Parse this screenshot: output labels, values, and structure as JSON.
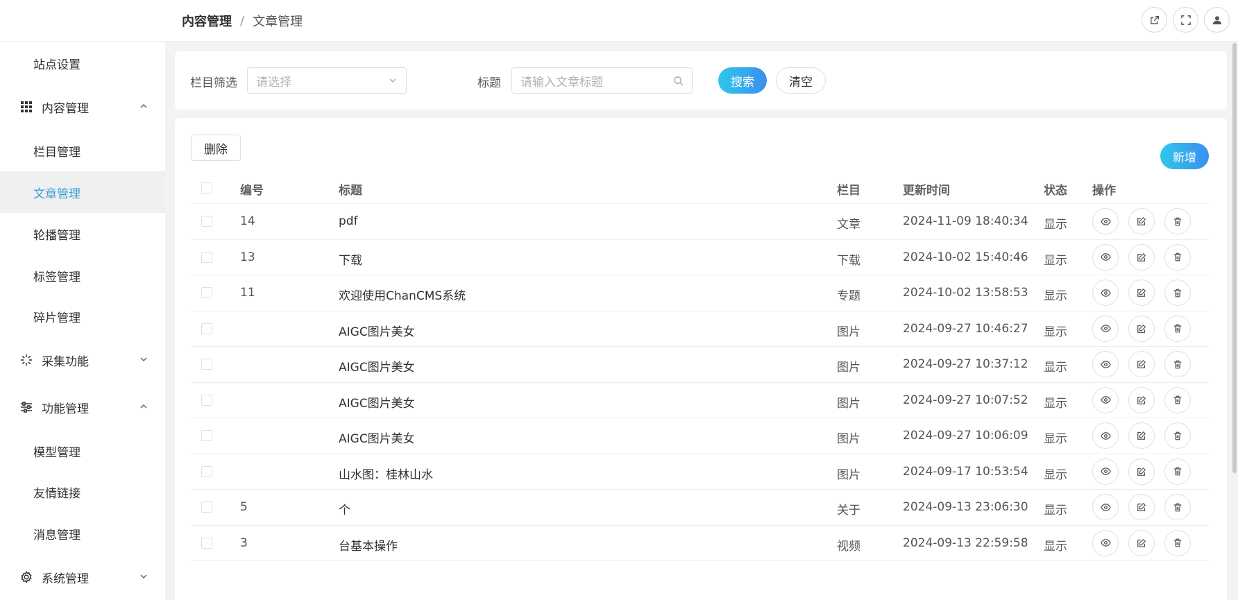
{
  "header": {
    "breadcrumb": [
      "内容管理",
      "文章管理"
    ],
    "icons": [
      "external-link-icon",
      "fullscreen-icon",
      "user-icon"
    ]
  },
  "sidebar": {
    "items": [
      {
        "label": "站点设置",
        "type": "sub"
      },
      {
        "label": "内容管理",
        "type": "group",
        "icon": "grid-icon",
        "expanded": true
      },
      {
        "label": "栏目管理",
        "type": "sub"
      },
      {
        "label": "文章管理",
        "type": "sub",
        "active": true
      },
      {
        "label": "轮播管理",
        "type": "sub"
      },
      {
        "label": "标签管理",
        "type": "sub"
      },
      {
        "label": "碎片管理",
        "type": "sub"
      },
      {
        "label": "采集功能",
        "type": "group",
        "icon": "loading-icon",
        "expanded": false
      },
      {
        "label": "功能管理",
        "type": "group",
        "icon": "sliders-icon",
        "expanded": true
      },
      {
        "label": "模型管理",
        "type": "sub"
      },
      {
        "label": "友情链接",
        "type": "sub"
      },
      {
        "label": "消息管理",
        "type": "sub"
      },
      {
        "label": "系统管理",
        "type": "group",
        "icon": "gear-icon",
        "expanded": false
      }
    ]
  },
  "search": {
    "category_label": "栏目筛选",
    "category_placeholder": "请选择",
    "title_label": "标题",
    "title_placeholder": "请输入文章标题",
    "search_button": "搜索",
    "clear_button": "清空"
  },
  "table": {
    "delete_button": "删除",
    "add_button": "新增",
    "columns": [
      "编号",
      "标题",
      "栏目",
      "更新时间",
      "状态",
      "操作"
    ],
    "rows": [
      {
        "id": "14",
        "title": "pdf",
        "category": "文章",
        "updated": "2024-11-09 18:40:34",
        "status": "显示"
      },
      {
        "id": "13",
        "title": "下载",
        "category": "下载",
        "updated": "2024-10-02 15:40:46",
        "status": "显示"
      },
      {
        "id": "11",
        "title": "欢迎使用ChanCMS系统",
        "category": "专题",
        "updated": "2024-10-02 13:58:53",
        "status": "显示"
      },
      {
        "id": "",
        "title": "AIGC图片美女",
        "category": "图片",
        "updated": "2024-09-27 10:46:27",
        "status": "显示"
      },
      {
        "id": "",
        "title": "AIGC图片美女",
        "category": "图片",
        "updated": "2024-09-27 10:37:12",
        "status": "显示"
      },
      {
        "id": "",
        "title": "AIGC图片美女",
        "category": "图片",
        "updated": "2024-09-27 10:07:52",
        "status": "显示"
      },
      {
        "id": "",
        "title": "AIGC图片美女",
        "category": "图片",
        "updated": "2024-09-27 10:06:09",
        "status": "显示"
      },
      {
        "id": "",
        "title": "山水图：桂林山水",
        "category": "图片",
        "updated": "2024-09-17 10:53:54",
        "status": "显示"
      },
      {
        "id": "5",
        "title": "个",
        "category": "关于",
        "updated": "2024-09-13 23:06:30",
        "status": "显示"
      },
      {
        "id": "3",
        "title": "台基本操作",
        "category": "视频",
        "updated": "2024-09-13 22:59:58",
        "status": "显示"
      }
    ]
  }
}
